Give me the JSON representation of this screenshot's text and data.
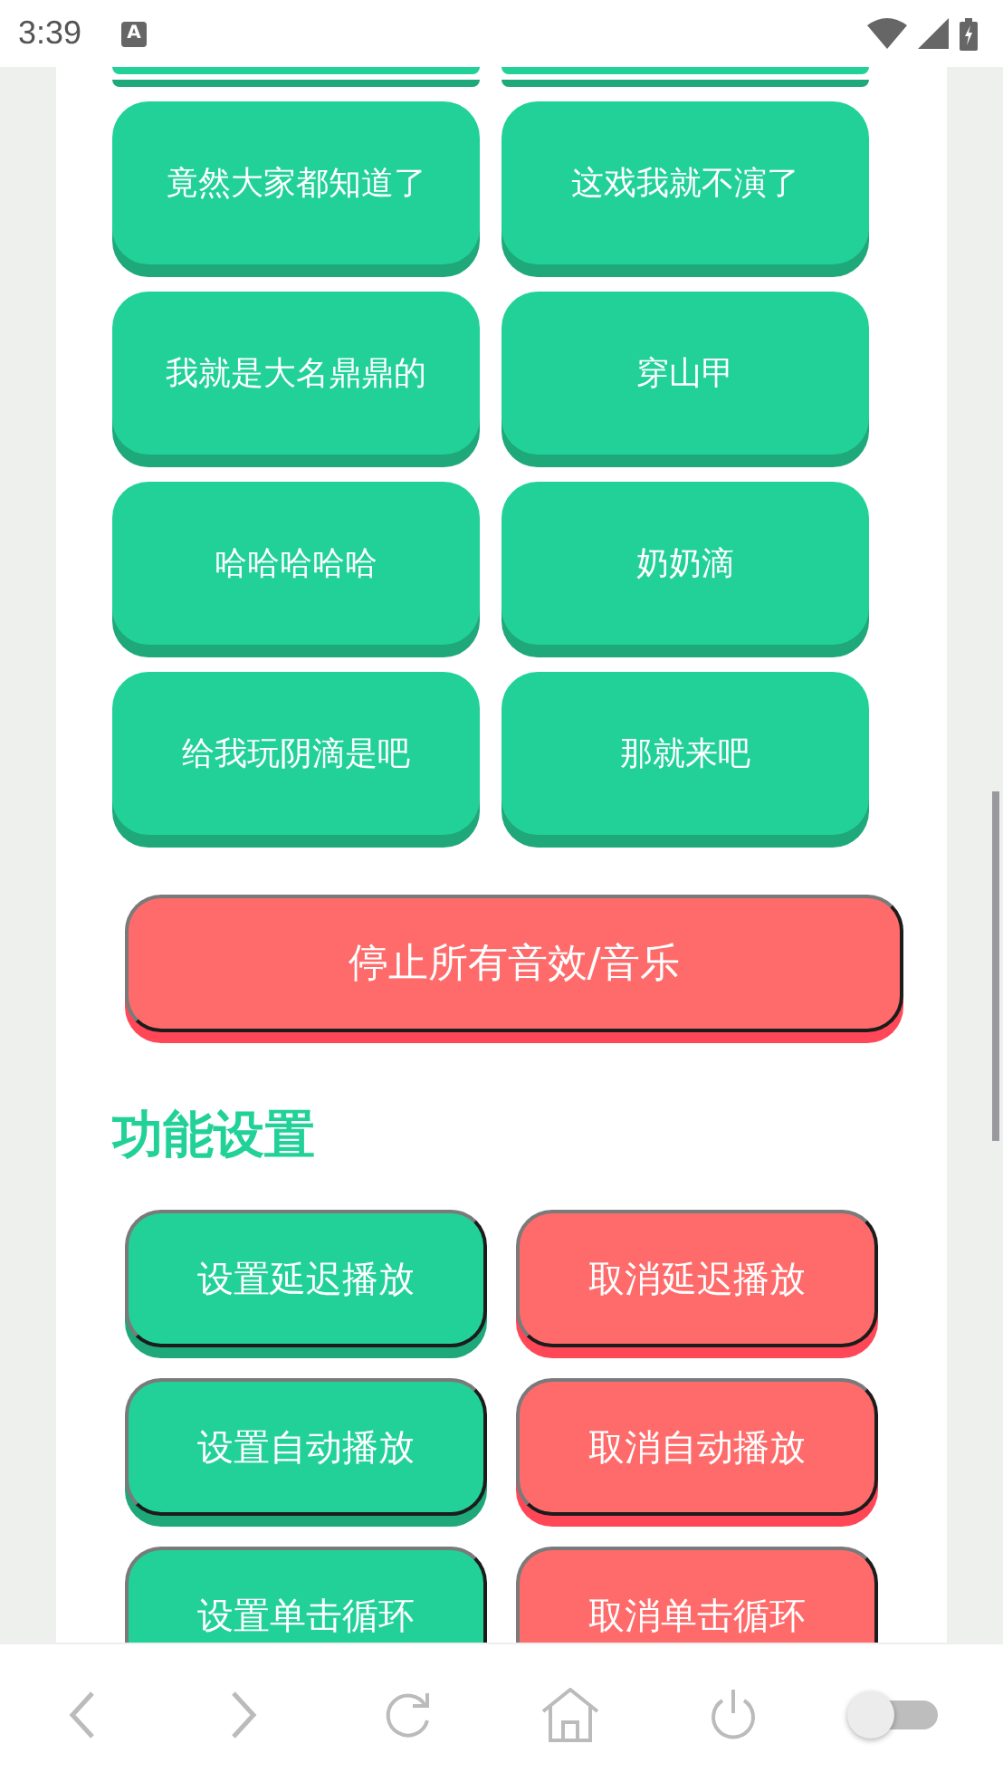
{
  "status_bar": {
    "time": "3:39",
    "notification_glyph": "A"
  },
  "sound_buttons": [
    {
      "label": "竟然大家都知道了"
    },
    {
      "label": "这戏我就不演了"
    },
    {
      "label": "我就是大名鼎鼎的"
    },
    {
      "label": "穿山甲"
    },
    {
      "label": "哈哈哈哈哈"
    },
    {
      "label": "奶奶滴"
    },
    {
      "label": "给我玩阴滴是吧"
    },
    {
      "label": "那就来吧"
    }
  ],
  "stop_button": {
    "label": "停止所有音效/音乐"
  },
  "section_title": "功能设置",
  "settings_buttons": [
    {
      "label": "设置延迟播放",
      "kind": "set"
    },
    {
      "label": "取消延迟播放",
      "kind": "cancel"
    },
    {
      "label": "设置自动播放",
      "kind": "set"
    },
    {
      "label": "取消自动播放",
      "kind": "cancel"
    },
    {
      "label": "设置单击循环",
      "kind": "set"
    },
    {
      "label": "取消单击循环",
      "kind": "cancel"
    }
  ],
  "bottom_bar": {
    "toggle": {
      "on": false
    }
  }
}
